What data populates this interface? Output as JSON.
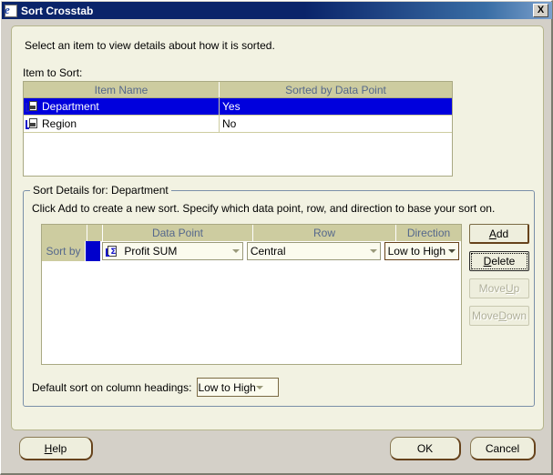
{
  "window": {
    "title": "Sort Crosstab",
    "icon": "ie-document-icon",
    "close_label": "X"
  },
  "panel": {
    "intro_text": "Select an item to view details about how it is sorted.",
    "item_to_sort_label": "Item to Sort:"
  },
  "item_grid": {
    "columns": [
      "Item Name",
      "Sorted by Data Point"
    ],
    "rows": [
      {
        "name": "Department",
        "sorted": "Yes",
        "selected": true,
        "icon": "dimension-icon"
      },
      {
        "name": "Region",
        "sorted": "No",
        "selected": false,
        "icon": "dimension-icon"
      }
    ]
  },
  "sort_details": {
    "group_title": "Sort Details for: Department",
    "instruction": "Click Add to create a new sort. Specify which data point, row, and direction to base your sort on.",
    "columns": [
      "",
      "",
      "Data Point",
      "Row",
      "Direction"
    ],
    "row": {
      "sort_by_label": "Sort by",
      "data_point": "Profit SUM",
      "data_point_icon": "sum-metric-icon",
      "row_value": "Central",
      "direction": "Low to High"
    },
    "buttons": [
      {
        "label": "Add",
        "mnemonic": "A",
        "before": "",
        "after": "dd",
        "disabled": false,
        "focused": false
      },
      {
        "label": "Delete",
        "mnemonic": "D",
        "before": "",
        "after": "elete",
        "disabled": false,
        "focused": true
      },
      {
        "label": "Move Up",
        "mnemonic": "U",
        "before": "Move ",
        "after": "p",
        "disabled": true,
        "focused": false
      },
      {
        "label": "Move Down",
        "mnemonic": "D",
        "before": "Move ",
        "after": "own",
        "disabled": true,
        "focused": false
      }
    ]
  },
  "default_sort": {
    "label": "Default sort on column headings:",
    "value": "Low to High"
  },
  "footer": {
    "help": {
      "before": "",
      "mnemonic": "H",
      "after": "elp"
    },
    "ok": "OK",
    "cancel": "Cancel"
  },
  "colors": {
    "title_bar": "#0a246a",
    "panel_bg": "#f2f2e2",
    "grid_header": "#cdcca0",
    "grid_header_text": "#55688c",
    "selection": "#0000dd",
    "button_face": "#eeeedd",
    "button_shadow": "#66421b"
  }
}
